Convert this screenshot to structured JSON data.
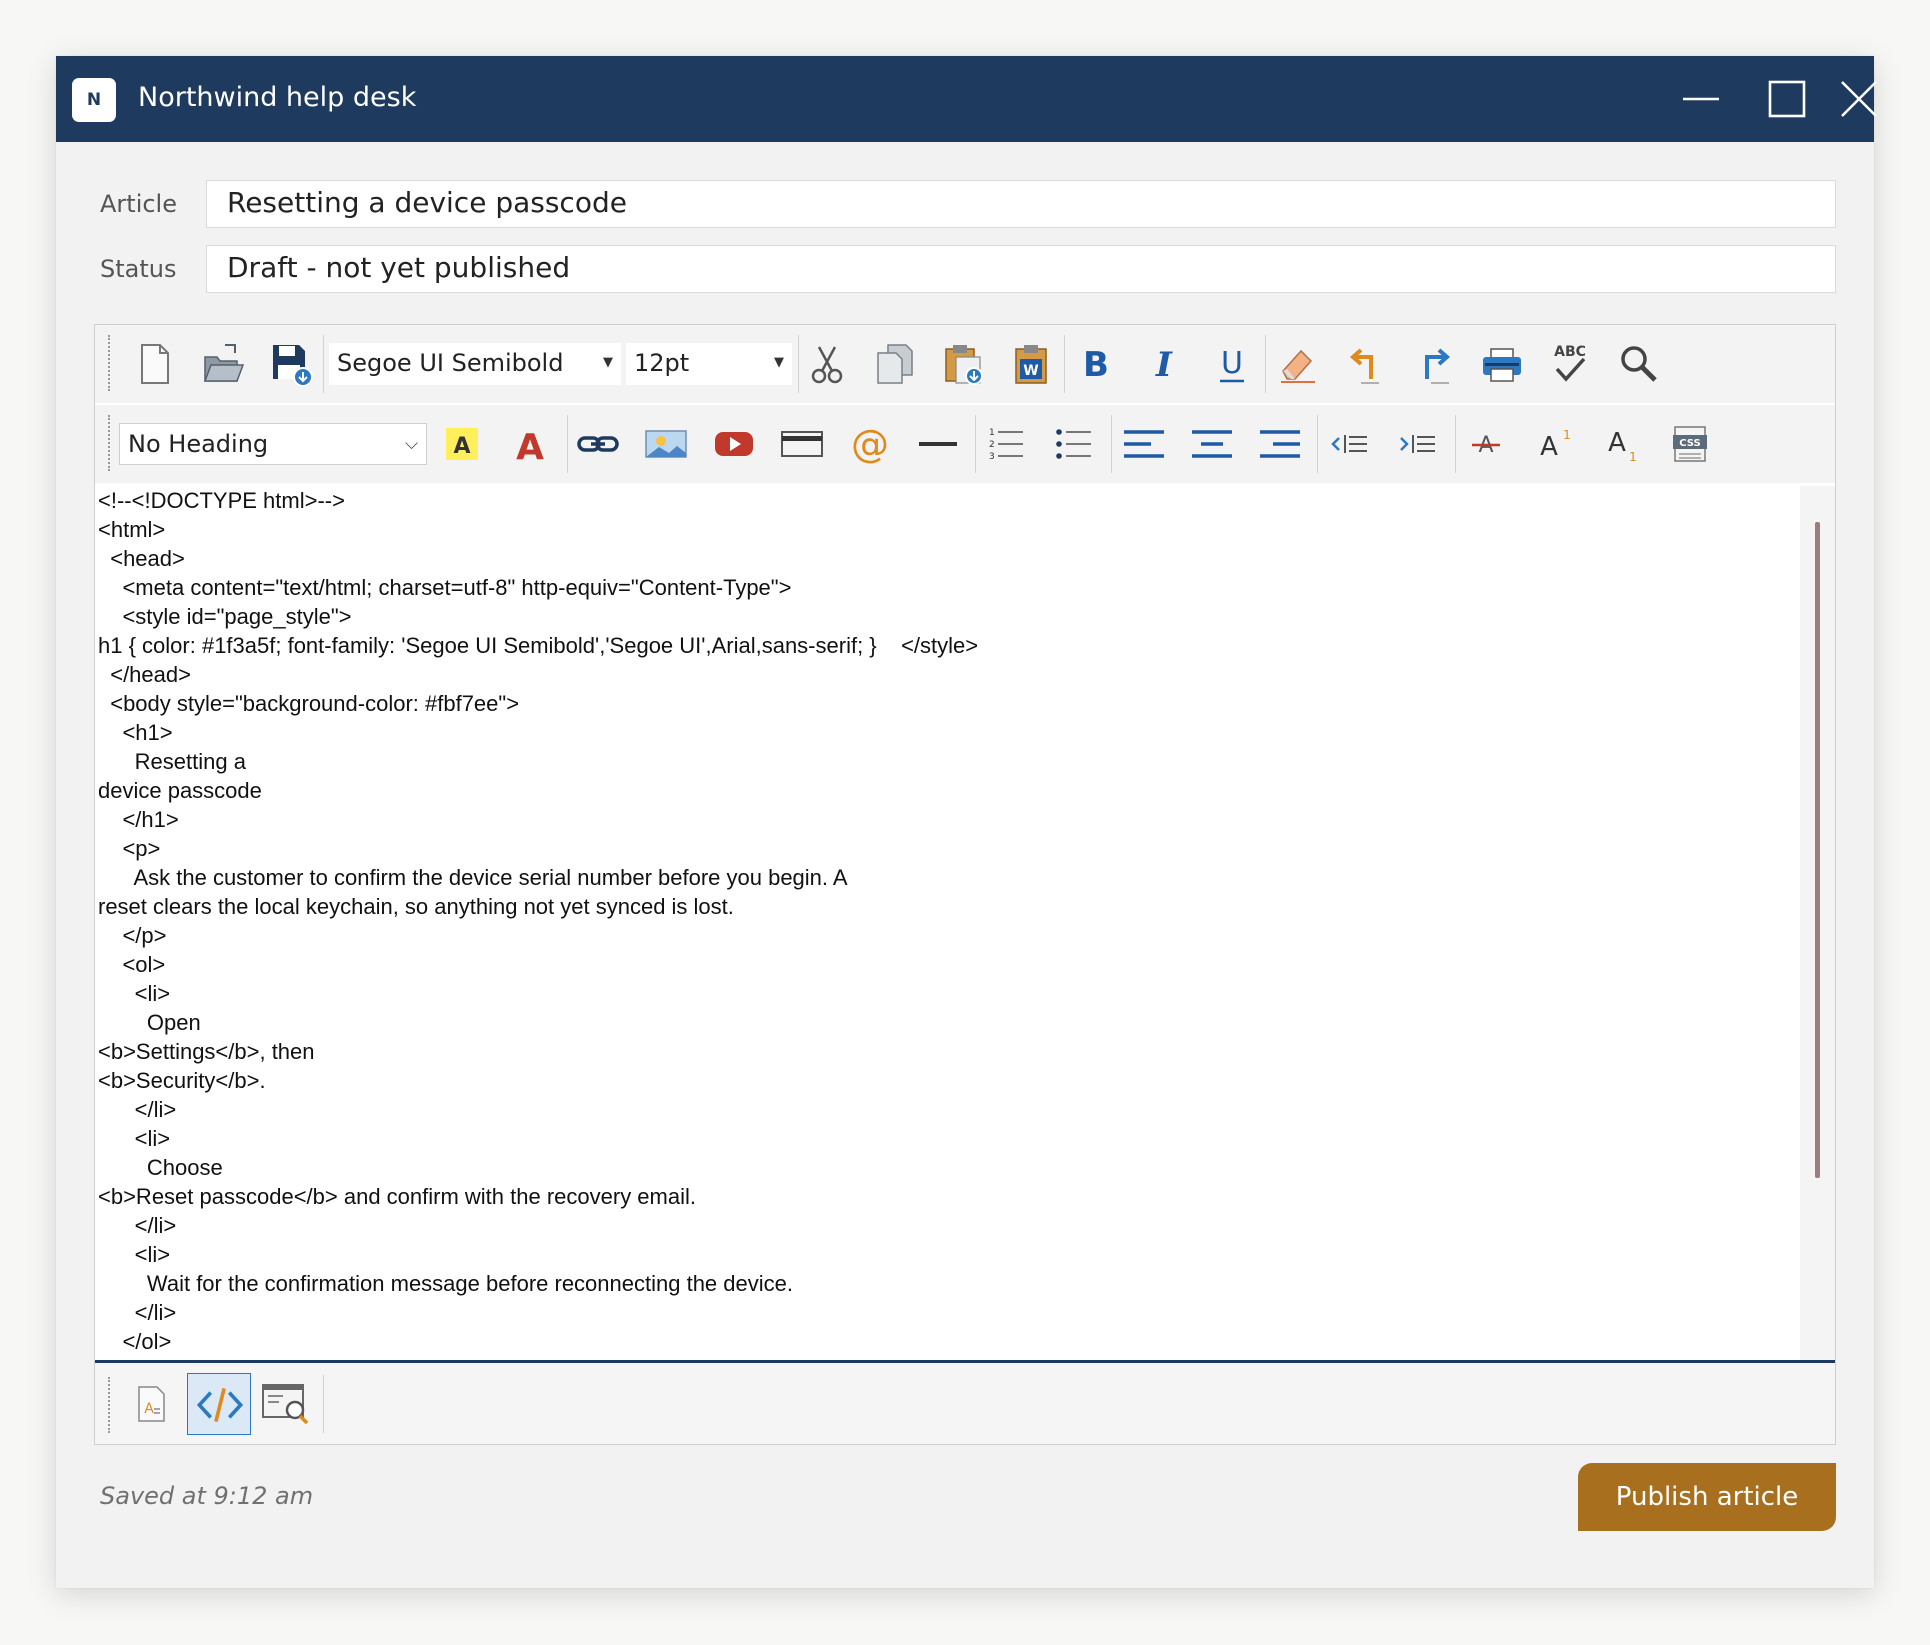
{
  "window": {
    "title": "Northwind help desk",
    "logo_letter": "N",
    "controls": [
      "minimize-icon",
      "maximize-icon",
      "close-icon"
    ]
  },
  "form": {
    "article_label": "Article",
    "article_value": "Resetting a device passcode",
    "status_label": "Status",
    "status_value": "Draft - not yet published"
  },
  "toolbar1": {
    "font_family": "Segoe UI Semibold",
    "font_size": "12pt",
    "icons": [
      "new-document-icon",
      "open-folder-icon",
      "save-icon",
      "cut-icon",
      "copy-icon",
      "paste-icon",
      "paste-from-word-icon",
      "bold-icon",
      "italic-icon",
      "underline-icon",
      "eraser-icon",
      "undo-icon",
      "redo-icon",
      "print-icon",
      "spellcheck-icon",
      "find-icon"
    ],
    "bold_glyph": "B",
    "italic_glyph": "I",
    "underline_glyph": "U",
    "spellcheck_glyph": "ABC",
    "word_glyph": "W"
  },
  "toolbar2": {
    "heading_style": "No Heading",
    "icons": [
      "highlight-color-icon",
      "font-color-icon",
      "link-icon",
      "image-icon",
      "video-icon",
      "table-icon",
      "email-link-icon",
      "horizontal-rule-icon",
      "numbered-list-icon",
      "bullet-list-icon",
      "align-left-icon",
      "align-center-icon",
      "align-right-icon",
      "outdent-icon",
      "indent-icon",
      "strikethrough-icon",
      "superscript-icon",
      "subscript-icon",
      "css-icon"
    ],
    "highlight_glyph": "A",
    "font_color_glyph": "A",
    "email_glyph": "@",
    "strike_glyph": "A",
    "super_glyph": "A",
    "super_digit": "1",
    "sub_glyph": "A",
    "sub_digit": "1",
    "css_glyph": "CSS",
    "numbered_digits": [
      "1",
      "2",
      "3"
    ]
  },
  "code_lines": [
    "<!--<!DOCTYPE html>-->",
    "<html>",
    "  <head>",
    "    <meta content=\"text/html; charset=utf-8\" http-equiv=\"Content-Type\">",
    "    <style id=\"page_style\">",
    "h1 { color: #1f3a5f; font-family: 'Segoe UI Semibold','Segoe UI',Arial,sans-serif; }    </style>",
    "  </head>",
    "  <body style=\"background-color: #fbf7ee\">",
    "    <h1>",
    "      Resetting a",
    "device passcode",
    "    </h1>",
    "    <p>",
    "      Ask the customer to confirm the device serial number before you begin. A",
    "reset clears the local keychain, so anything not yet synced is lost.",
    "    </p>",
    "    <ol>",
    "      <li>",
    "        Open",
    "<b>Settings</b>, then",
    "<b>Security</b>.",
    "      </li>",
    "      <li>",
    "        Choose",
    "<b>Reset passcode</b> and confirm with the recovery email.",
    "      </li>",
    "      <li>",
    "        Wait for the confirmation message before reconnecting the device.",
    "      </li>",
    "    </ol>"
  ],
  "mode_tabs": [
    {
      "name": "design-view-icon",
      "active": false
    },
    {
      "name": "html-source-icon",
      "active": true
    },
    {
      "name": "preview-icon",
      "active": false
    }
  ],
  "footer": {
    "saved_text": "Saved at 9:12 am",
    "publish_label": "Publish article"
  },
  "colors": {
    "titlebar": "#1f3a5f",
    "publish_button": "#a8701e",
    "accent_blue": "#2b79c2",
    "red_icon": "#c0392b",
    "orange_icon": "#e08a1e"
  }
}
